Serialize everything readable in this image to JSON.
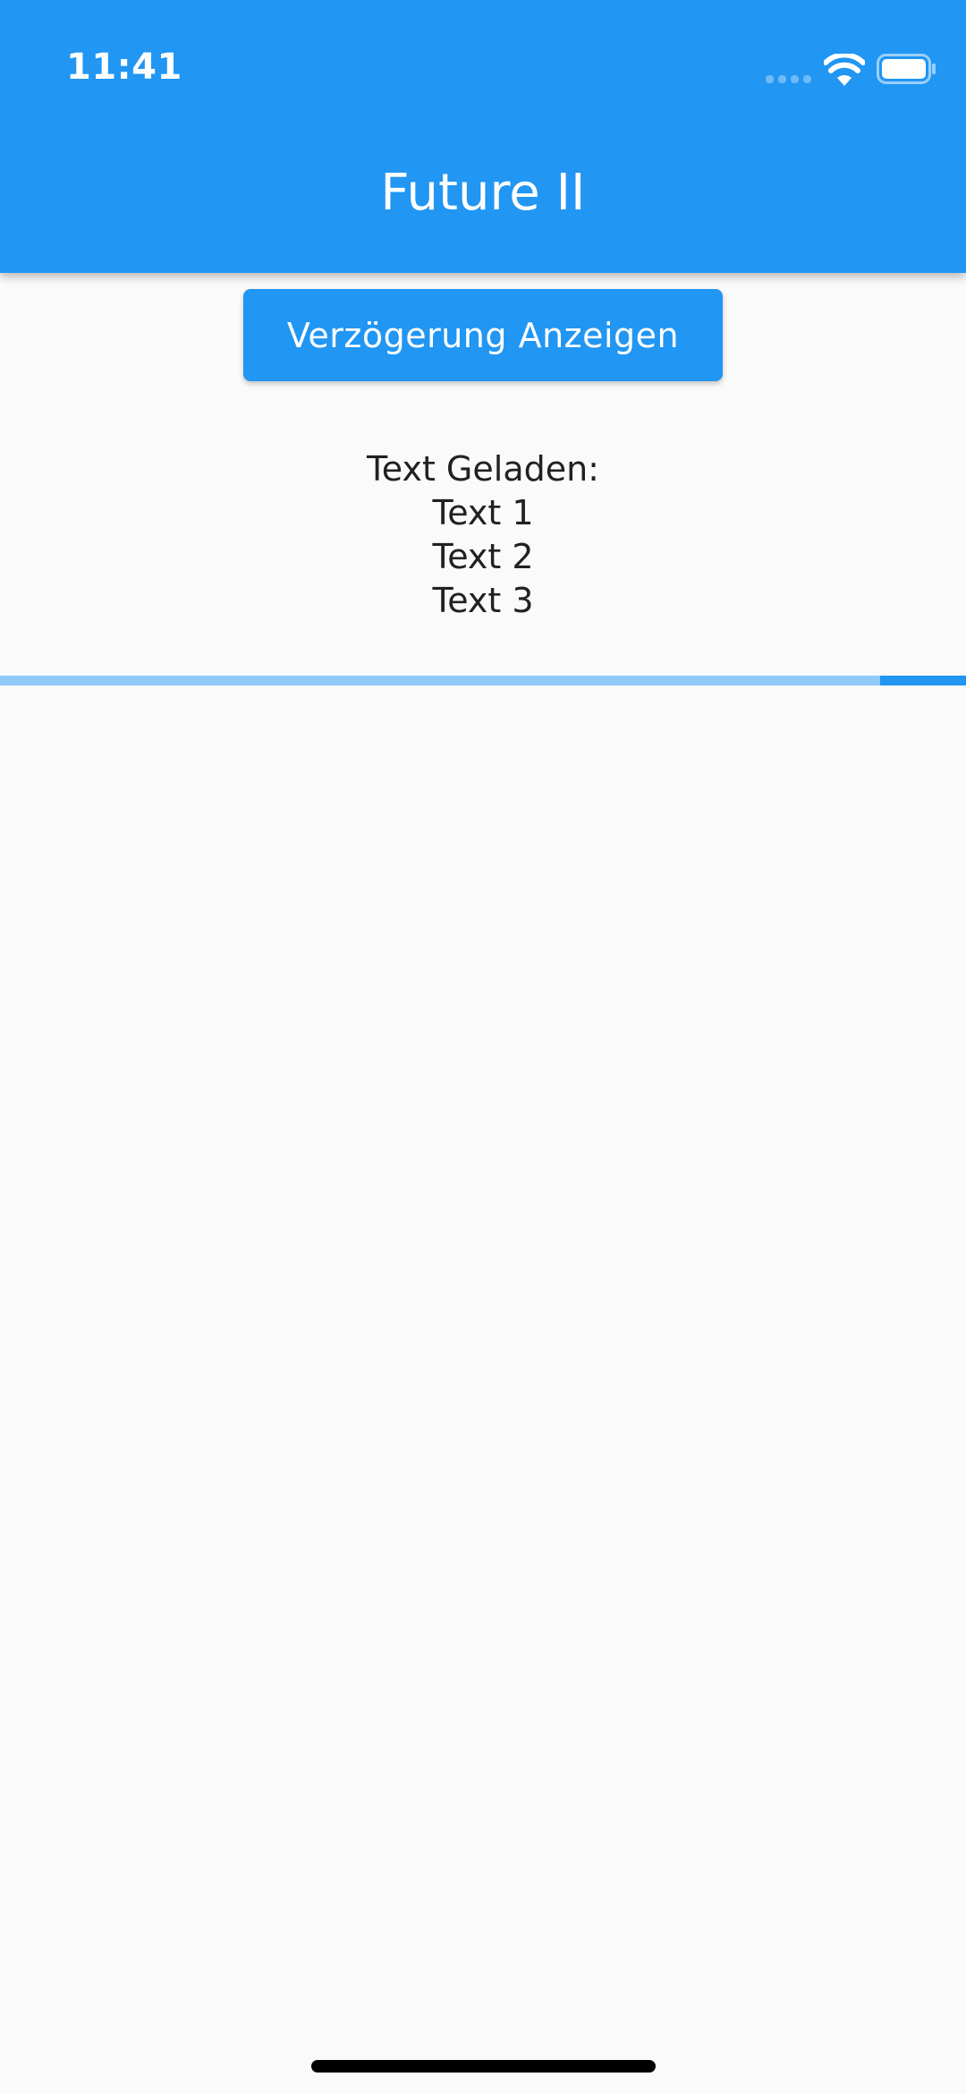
{
  "status_bar": {
    "time": "11:41"
  },
  "app_bar": {
    "title": "Future II",
    "color": "#2196f3"
  },
  "delay_button": {
    "label": "Verzögerung Anzeigen"
  },
  "loaded_text": {
    "heading": "Text Geladen:",
    "items": [
      "Text 1",
      "Text 2",
      "Text 3"
    ]
  },
  "progress": {
    "indicator_start": 0.911,
    "indicator_end": 1.0,
    "track_color": "#90caf9",
    "indicator_color": "#2196f3"
  },
  "icons": {
    "signal": "cellular-signal-icon",
    "wifi": "wifi-icon",
    "battery": "battery-icon"
  }
}
